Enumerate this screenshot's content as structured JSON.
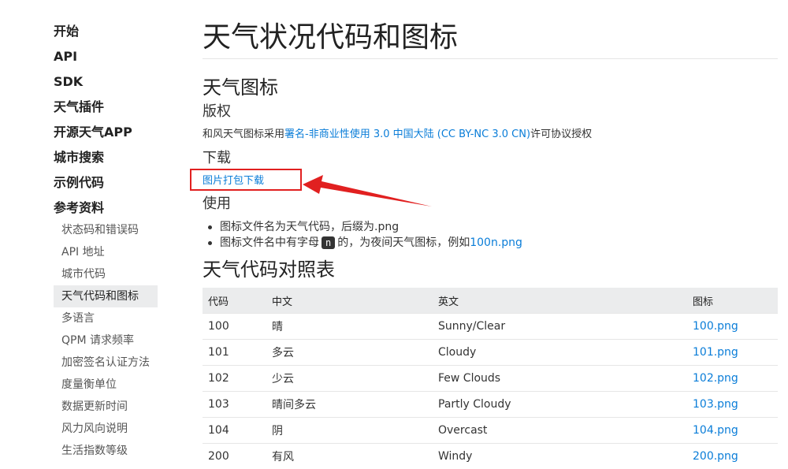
{
  "sidebar": {
    "main_items": [
      {
        "label": "开始"
      },
      {
        "label": "API"
      },
      {
        "label": "SDK"
      },
      {
        "label": "天气插件"
      },
      {
        "label": "开源天气APP"
      },
      {
        "label": "城市搜索"
      },
      {
        "label": "示例代码"
      },
      {
        "label": "参考资料"
      }
    ],
    "sub_items": [
      {
        "label": "状态码和错误码"
      },
      {
        "label": "API 地址"
      },
      {
        "label": "城市代码"
      },
      {
        "label": "天气代码和图标",
        "active": true
      },
      {
        "label": "多语言"
      },
      {
        "label": "QPM 请求频率"
      },
      {
        "label": "加密签名认证方法"
      },
      {
        "label": "度量衡单位"
      },
      {
        "label": "数据更新时间"
      },
      {
        "label": "风力风向说明"
      },
      {
        "label": "生活指数等级"
      }
    ]
  },
  "main": {
    "title": "天气状况代码和图标",
    "icons_section": {
      "heading": "天气图标",
      "copyright_heading": "版权",
      "copyright_prefix": "和风天气图标采用",
      "license_link": "署名-非商业性使用 3.0 中国大陆 (CC BY-NC 3.0 CN)",
      "copyright_suffix": "许可协议授权",
      "download_heading": "下载",
      "download_link": "图片打包下载",
      "usage_heading": "使用",
      "usage_1": "图标文件名为天气代码，后缀为.png",
      "usage_2_prefix": "图标文件名中有字母",
      "usage_2_code": "n",
      "usage_2_mid": "的，为夜间天气图标，例如",
      "usage_2_link": "100n.png"
    },
    "table_section": {
      "heading": "天气代码对照表",
      "columns": [
        "代码",
        "中文",
        "英文",
        "图标"
      ],
      "rows": [
        [
          "100",
          "晴",
          "Sunny/Clear",
          "100.png"
        ],
        [
          "101",
          "多云",
          "Cloudy",
          "101.png"
        ],
        [
          "102",
          "少云",
          "Few Clouds",
          "102.png"
        ],
        [
          "103",
          "晴间多云",
          "Partly Cloudy",
          "103.png"
        ],
        [
          "104",
          "阴",
          "Overcast",
          "104.png"
        ],
        [
          "200",
          "有风",
          "Windy",
          "200.png"
        ]
      ]
    }
  },
  "colors": {
    "link": "#0a7dd8",
    "highlight": "#e12020",
    "table_header_bg": "#ebeced"
  }
}
